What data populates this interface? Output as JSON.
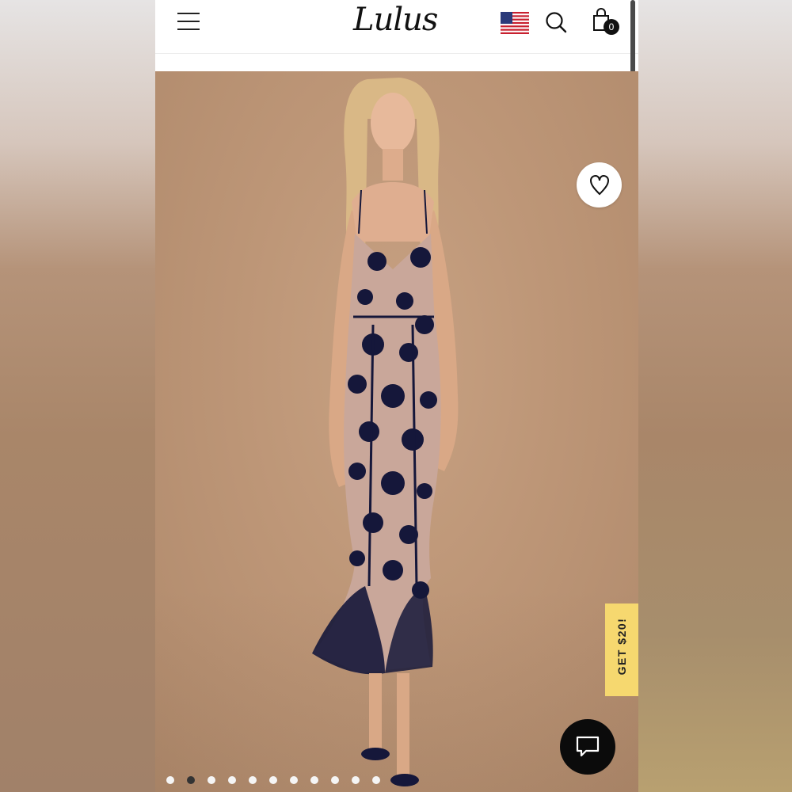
{
  "header": {
    "logo_text": "Lulus",
    "cart_count": "0",
    "icons": [
      "hamburger-menu-icon",
      "us-flag-icon",
      "search-icon",
      "shopping-bag-icon"
    ]
  },
  "gallery": {
    "slide_count": 11,
    "active_index": 1
  },
  "promo": {
    "label": "GET $20!",
    "color": "#f6d86f"
  },
  "colors": {
    "background": "#bd9677",
    "accent": "#0b0b0b",
    "dress": "#15173a"
  }
}
